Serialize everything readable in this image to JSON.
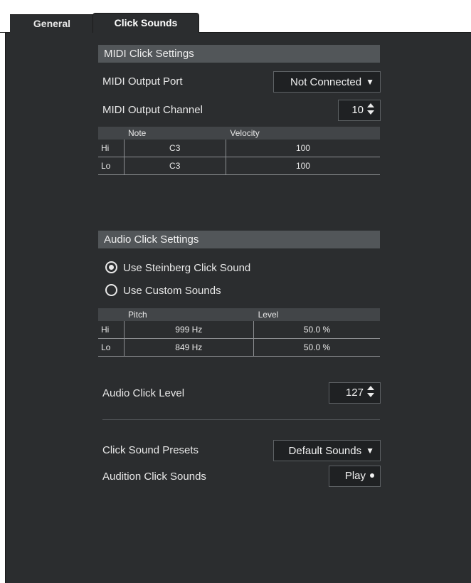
{
  "tabs": [
    {
      "label": "General"
    },
    {
      "label": "Click Sounds"
    }
  ],
  "midi": {
    "header": "MIDI Click Settings",
    "output_port_label": "MIDI Output Port",
    "output_port_value": "Not Connected",
    "output_channel_label": "MIDI Output Channel",
    "output_channel_value": "10",
    "table": {
      "columns": [
        "Note",
        "Velocity"
      ],
      "rows": [
        {
          "name": "Hi",
          "note": "C3",
          "velocity": "100"
        },
        {
          "name": "Lo",
          "note": "C3",
          "velocity": "100"
        }
      ]
    }
  },
  "audio": {
    "header": "Audio Click Settings",
    "option_steinberg": "Use Steinberg Click Sound",
    "option_custom": "Use Custom Sounds",
    "selected_option": "Use Steinberg Click Sound",
    "table": {
      "columns": [
        "Pitch",
        "Level"
      ],
      "rows": [
        {
          "name": "Hi",
          "pitch": "999 Hz",
          "level": "50.0 %"
        },
        {
          "name": "Lo",
          "pitch": "849 Hz",
          "level": "50.0 %"
        }
      ]
    },
    "level_label": "Audio Click Level",
    "level_value": "127"
  },
  "presets": {
    "label": "Click Sound Presets",
    "value": "Default Sounds",
    "audition_label": "Audition Click Sounds",
    "play_label": "Play"
  }
}
